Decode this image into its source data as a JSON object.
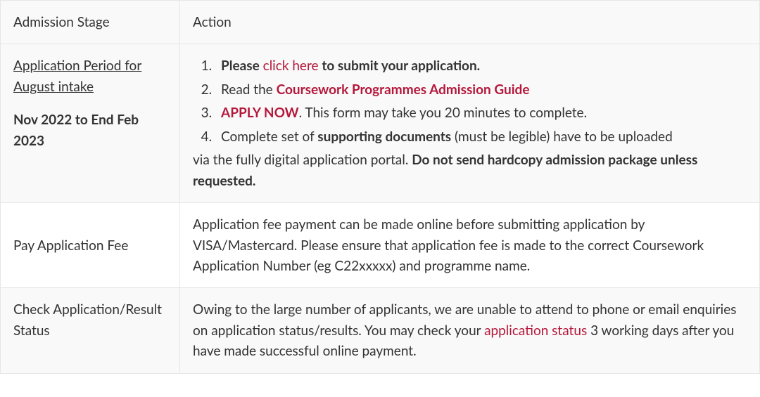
{
  "header": {
    "stage": "Admission Stage",
    "action": "Action"
  },
  "rows": {
    "r0": {
      "stage_title": "Application Period for August intake",
      "stage_date": "Nov 2022 to End Feb 2023",
      "li1_prefix": "Please",
      "li1_link": "click here",
      "li1_suffix": "to submit your application.",
      "li2_prefix": "Read the",
      "li2_link": "Coursework Programmes Admission Guide",
      "li3_link": "APPLY NOW",
      "li3_suffix": ".  This form may take you 20 minutes to complete.",
      "li4_prefix": "Complete set of",
      "li4_bold1": "supporting documents",
      "li4_mid": "(must be legible) have to be uploaded",
      "li4_cont_prefix": "via the fully digital application portal.",
      "li4_cont_bold": "Do not send hardcopy admission package unless requested."
    },
    "r1": {
      "stage": "Pay Application Fee",
      "action": "Application fee payment can be made online before submitting application by VISA/Mastercard. Please ensure that application fee is made to the correct Coursework Application Number (eg C22xxxxx) and programme name."
    },
    "r2": {
      "stage": "Check Application/Result Status",
      "action_prefix": "Owing to the large number of applicants, we are unable to attend to phone or email enquiries on application status/results. You may check your",
      "action_link": "application status",
      "action_suffix": "3 working days after you have made successful online payment."
    }
  }
}
